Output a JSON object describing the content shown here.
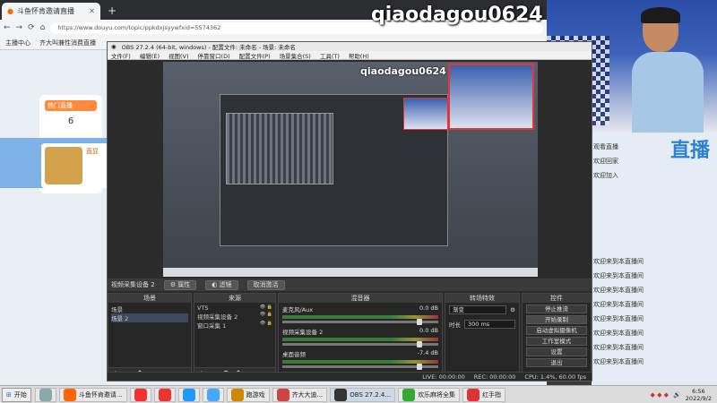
{
  "browser": {
    "tab_title": "斗鱼怀肯邀请直播",
    "url": "https://www.douyu.com/topic/ppkdxjsyywfxid=5574362",
    "bookmarks": [
      "主播中心",
      "齐大叫兼性消费直播"
    ]
  },
  "web": {
    "card_tag": "热门直播",
    "card_count": "6",
    "streamer_label": "直显"
  },
  "stream": {
    "watermark": "qiaodagou0624"
  },
  "chat": {
    "logo": "直播",
    "rows": [
      {
        "badge": "",
        "name": "",
        "text": "观看直播"
      },
      {
        "badge": "",
        "name": "",
        "text": "欢迎回家"
      },
      {
        "badge": "",
        "name": "",
        "text": "欢迎加入"
      },
      {
        "badge": "",
        "name": "",
        "text": ""
      },
      {
        "badge": "",
        "name": "",
        "text": ""
      },
      {
        "badge": "",
        "name": "",
        "text": ""
      },
      {
        "badge": "",
        "name": "",
        "text": ""
      },
      {
        "badge": "",
        "name": "",
        "text": ""
      },
      {
        "badge": "",
        "name": "",
        "text": "欢迎来到本直播间"
      },
      {
        "badge": "",
        "name": "",
        "text": "欢迎来到本直播间"
      },
      {
        "badge": "",
        "name": "",
        "text": "欢迎来到本直播间"
      },
      {
        "badge": "",
        "name": "",
        "text": "欢迎来到本直播间"
      },
      {
        "badge": "",
        "name": "",
        "text": "欢迎来到本直播间"
      },
      {
        "badge": "",
        "name": "",
        "text": "欢迎来到本直播间"
      },
      {
        "badge": "",
        "name": "",
        "text": "欢迎来到本直播间"
      },
      {
        "badge": "",
        "name": "",
        "text": "欢迎来到本直播间"
      }
    ]
  },
  "obs": {
    "title": "OBS 27.2.4 (64-bit, windows) - 配置文件: 未命名 - 场景: 未命名",
    "menu": [
      "文件(F)",
      "编辑(E)",
      "视图(V)",
      "停靠窗口(D)",
      "配置文件(P)",
      "场景集合(S)",
      "工具(T)",
      "帮助(H)"
    ],
    "source_bar": {
      "selected": "视频采集设备 2",
      "properties": "属性",
      "filters": "滤镜",
      "deactivate": "取消激活"
    },
    "docks": {
      "scenes": {
        "title": "场景",
        "items": [
          "场景",
          "场景 2"
        ],
        "selected": 1
      },
      "sources": {
        "title": "来源",
        "items": [
          "VTS",
          "视频采集设备 2",
          "窗口采集 1"
        ]
      },
      "mixer": {
        "title": "混音器",
        "channels": [
          {
            "name": "麦克风/Aux",
            "db": "0.0 dB"
          },
          {
            "name": "视频采集设备 2",
            "db": "0.0 dB"
          },
          {
            "name": "桌面音频",
            "db": "-7.4 dB"
          }
        ]
      },
      "transitions": {
        "title": "转场特效",
        "type": "渐变",
        "duration_label": "时长",
        "duration": "300 ms"
      },
      "controls": {
        "title": "控件",
        "buttons": [
          "停止推流",
          "开始录制",
          "启动虚拟摄像机",
          "工作室模式",
          "设置",
          "退出"
        ]
      }
    },
    "status": {
      "live": "LIVE: 00:00:00",
      "rec": "REC: 00:00:00",
      "cpu": "CPU: 1.4%, 60.00 fps"
    }
  },
  "taskbar": {
    "start": "开始",
    "items": [
      {
        "label": "",
        "color": "#8aa"
      },
      {
        "label": "斗鱼怀肯邀请...",
        "color": "#f60"
      },
      {
        "label": "",
        "color": "#e33"
      },
      {
        "label": "",
        "color": "#e33"
      },
      {
        "label": "",
        "color": "#29f"
      },
      {
        "label": "",
        "color": "#4af"
      },
      {
        "label": "跑游戏",
        "color": "#c80"
      },
      {
        "label": "齐大大迪...",
        "color": "#c44"
      },
      {
        "label": "OBS 27.2.4...",
        "color": "#333",
        "active": true
      },
      {
        "label": "欢乐麻将全集",
        "color": "#3a3"
      },
      {
        "label": "红手指",
        "color": "#d33"
      }
    ],
    "time": "6:56",
    "date": "2022/9/2"
  }
}
